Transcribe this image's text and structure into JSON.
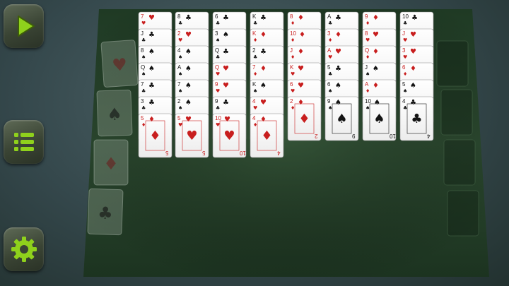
{
  "colors": {
    "felt": "#2d4a30",
    "felt_dark": "#1f3622",
    "accent_green": "#8fd11c",
    "red_suit": "#c81e1e",
    "black_suit": "#141414"
  },
  "sidebar": {
    "buttons": [
      {
        "id": "play",
        "icon": "play-icon"
      },
      {
        "id": "menu",
        "icon": "menu-icon"
      },
      {
        "id": "settings",
        "icon": "gear-icon"
      }
    ]
  },
  "foundations": [
    {
      "suit": "♥",
      "color": "red"
    },
    {
      "suit": "♠",
      "color": "black"
    },
    {
      "suit": "♦",
      "color": "red"
    },
    {
      "suit": "♣",
      "color": "black"
    }
  ],
  "free_cells": 4,
  "tableau": [
    {
      "cards": [
        {
          "rank": "7",
          "suit": "♥"
        },
        {
          "rank": "J",
          "suit": "♣"
        },
        {
          "rank": "8",
          "suit": "♠"
        },
        {
          "rank": "Q",
          "suit": "♠"
        },
        {
          "rank": "7",
          "suit": "♣"
        },
        {
          "rank": "3",
          "suit": "♣"
        },
        {
          "rank": "5",
          "suit": "♦"
        }
      ]
    },
    {
      "cards": [
        {
          "rank": "8",
          "suit": "♣"
        },
        {
          "rank": "2",
          "suit": "♥"
        },
        {
          "rank": "4",
          "suit": "♠"
        },
        {
          "rank": "A",
          "suit": "♠"
        },
        {
          "rank": "7",
          "suit": "♠"
        },
        {
          "rank": "2",
          "suit": "♠"
        },
        {
          "rank": "5",
          "suit": "♥"
        }
      ]
    },
    {
      "cards": [
        {
          "rank": "6",
          "suit": "♣"
        },
        {
          "rank": "3",
          "suit": "♠"
        },
        {
          "rank": "Q",
          "suit": "♣"
        },
        {
          "rank": "Q",
          "suit": "♥"
        },
        {
          "rank": "9",
          "suit": "♥"
        },
        {
          "rank": "9",
          "suit": "♣"
        },
        {
          "rank": "10",
          "suit": "♥"
        }
      ]
    },
    {
      "cards": [
        {
          "rank": "K",
          "suit": "♣"
        },
        {
          "rank": "K",
          "suit": "♦"
        },
        {
          "rank": "2",
          "suit": "♣"
        },
        {
          "rank": "7",
          "suit": "♦"
        },
        {
          "rank": "K",
          "suit": "♠"
        },
        {
          "rank": "4",
          "suit": "♥"
        },
        {
          "rank": "4",
          "suit": "♦"
        }
      ]
    },
    {
      "cards": [
        {
          "rank": "8",
          "suit": "♦"
        },
        {
          "rank": "10",
          "suit": "♦"
        },
        {
          "rank": "J",
          "suit": "♦"
        },
        {
          "rank": "K",
          "suit": "♥"
        },
        {
          "rank": "6",
          "suit": "♥"
        },
        {
          "rank": "2",
          "suit": "♦"
        }
      ]
    },
    {
      "cards": [
        {
          "rank": "A",
          "suit": "♣"
        },
        {
          "rank": "3",
          "suit": "♦"
        },
        {
          "rank": "A",
          "suit": "♥"
        },
        {
          "rank": "5",
          "suit": "♣"
        },
        {
          "rank": "6",
          "suit": "♠"
        },
        {
          "rank": "9",
          "suit": "♠"
        }
      ]
    },
    {
      "cards": [
        {
          "rank": "9",
          "suit": "♦"
        },
        {
          "rank": "8",
          "suit": "♥"
        },
        {
          "rank": "Q",
          "suit": "♦"
        },
        {
          "rank": "J",
          "suit": "♠"
        },
        {
          "rank": "A",
          "suit": "♦"
        },
        {
          "rank": "10",
          "suit": "♠"
        }
      ]
    },
    {
      "cards": [
        {
          "rank": "10",
          "suit": "♣"
        },
        {
          "rank": "J",
          "suit": "♥"
        },
        {
          "rank": "3",
          "suit": "♥"
        },
        {
          "rank": "6",
          "suit": "♦"
        },
        {
          "rank": "5",
          "suit": "♠"
        },
        {
          "rank": "4",
          "suit": "♣"
        }
      ]
    }
  ]
}
